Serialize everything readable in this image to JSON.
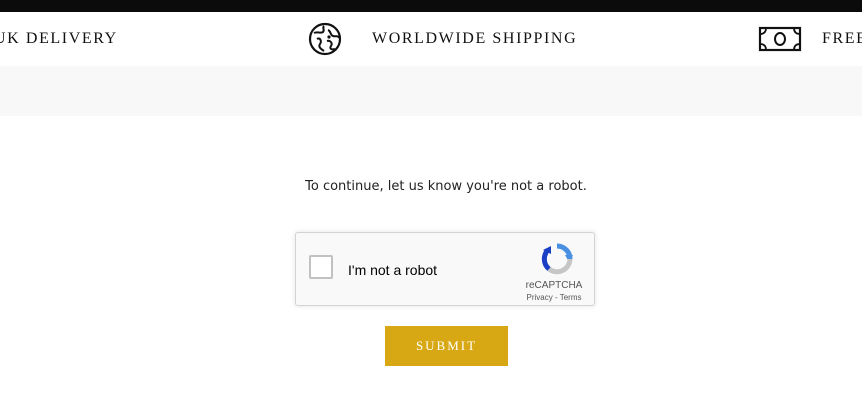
{
  "promo_bar": {
    "items": [
      {
        "label": "UK DELIVERY"
      },
      {
        "label": "WORLDWIDE SHIPPING",
        "icon": "globe-icon"
      },
      {
        "label": "FREE",
        "icon": "banknote-icon"
      }
    ]
  },
  "captcha_page": {
    "message": "To continue, let us know you're not a robot.",
    "recaptcha": {
      "label": "I'm not a robot",
      "brand": "reCAPTCHA",
      "privacy": "Privacy",
      "separator": "-",
      "terms": "Terms",
      "icon": "recaptcha-logo-icon"
    },
    "submit_label": "SUBMIT"
  },
  "colors": {
    "top_bar": "#0b0b0b",
    "band": "#f8f8f8",
    "submit_button": "#d7a814"
  }
}
